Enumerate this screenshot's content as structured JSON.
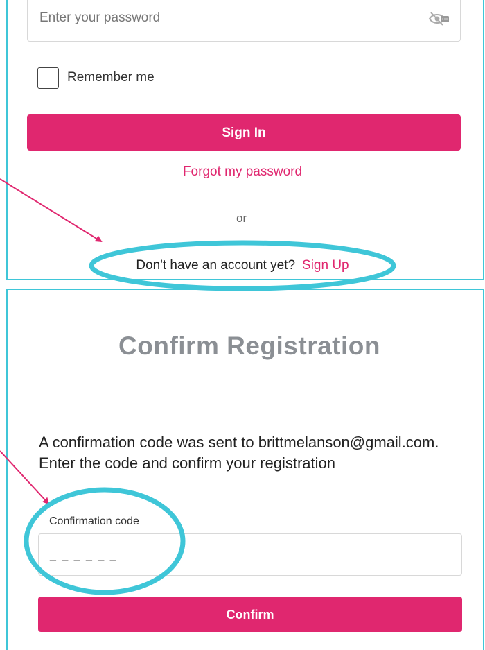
{
  "sign_in": {
    "password_placeholder": "Enter your password",
    "remember_label": "Remember me",
    "signin_label": "Sign In",
    "forgot_label": "Forgot my password",
    "divider_text": "or",
    "signup_prompt": "Don't have an account yet?",
    "signup_label": "Sign Up"
  },
  "confirm": {
    "title": "Confirm Registration",
    "message": "A confirmation code was sent to brittmelanson@gmail.com. Enter the code and confirm your registration",
    "code_label": "Confirmation code",
    "code_placeholder": "_ _ _ _ _ _",
    "confirm_label": "Confirm"
  },
  "icons": {
    "password_toggle": "eye-slash-icon"
  },
  "colors": {
    "brand_pink": "#e0276f",
    "highlight_cyan": "#3fc6d8",
    "title_gray": "#8b8f94"
  }
}
